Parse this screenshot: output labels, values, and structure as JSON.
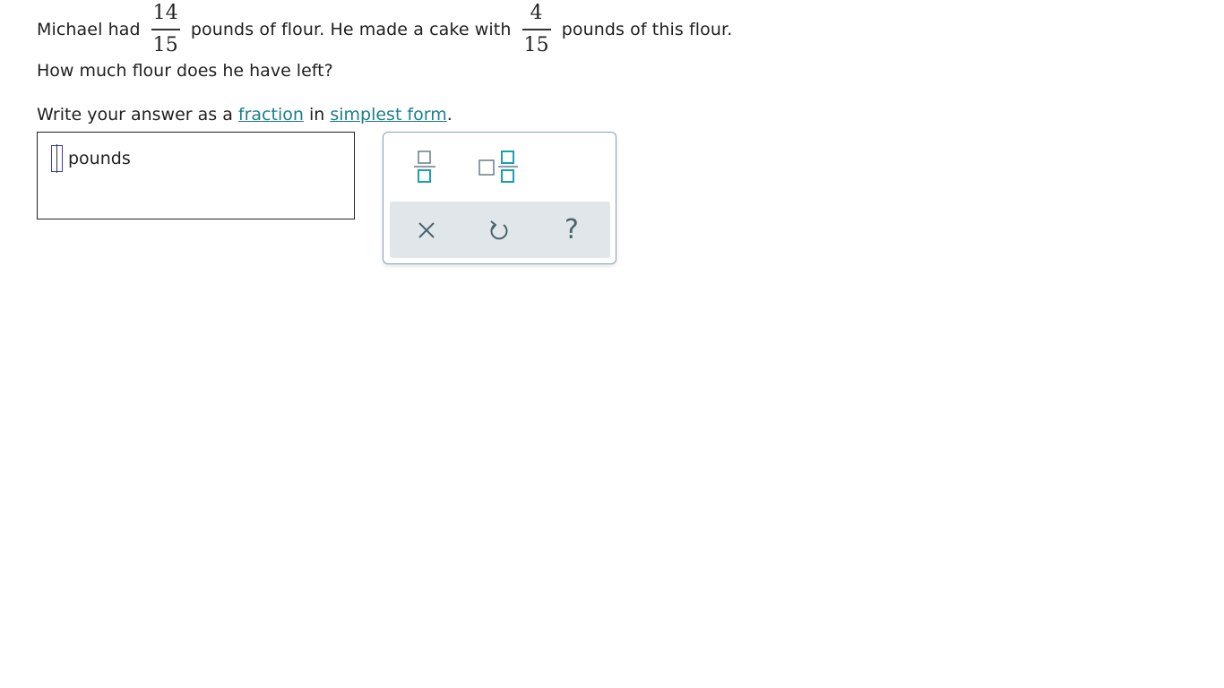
{
  "problem": {
    "text_before": "Michael had",
    "frac1": {
      "num": "14",
      "den": "15"
    },
    "text_middle": "pounds of flour. He made a cake with",
    "frac2": {
      "num": "4",
      "den": "15"
    },
    "text_after": "pounds of this flour.",
    "question": "How much flour does he have left?"
  },
  "instruction": {
    "prefix": "Write your answer as a",
    "link1": "fraction",
    "middle": "in",
    "link2": "simplest form",
    "suffix": "."
  },
  "answer": {
    "value": "",
    "unit": "pounds"
  },
  "keypad": {
    "keys": [
      {
        "name": "fraction-key",
        "icon": "fraction-icon"
      },
      {
        "name": "mixed-number-key",
        "icon": "mixed-number-icon"
      }
    ],
    "tools": [
      {
        "name": "clear",
        "icon": "close-icon"
      },
      {
        "name": "undo",
        "icon": "undo-icon"
      },
      {
        "name": "help",
        "label": "?"
      }
    ],
    "colors": {
      "accent": "#1a9fb4",
      "border": "#8aa4b4",
      "tool_bg": "#e0e6e9",
      "tool_icon": "#4b6270"
    }
  },
  "colors": {
    "link": "#1a7f8e",
    "text": "#1f1f1f",
    "cursor": "#3a3ad6"
  }
}
